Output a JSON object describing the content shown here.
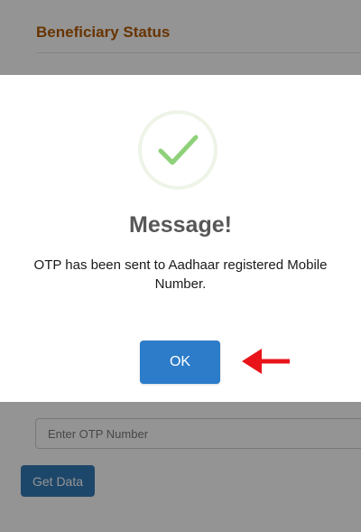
{
  "page": {
    "section_title": "Beneficiary Status",
    "otp_input": {
      "placeholder": "Enter OTP Number",
      "value": ""
    },
    "get_data_label": "Get Data"
  },
  "dialog": {
    "icon": "checkmark-icon",
    "title": "Message!",
    "message": "OTP has been sent to Aadhaar registered Mobile Number.",
    "ok_label": "OK"
  },
  "annotation": {
    "icon": "red-arrow-icon",
    "color": "#e8141a"
  },
  "colors": {
    "accent_title": "#b35a00",
    "button_blue": "#2c7cc9",
    "check_green": "#8fd17a"
  }
}
